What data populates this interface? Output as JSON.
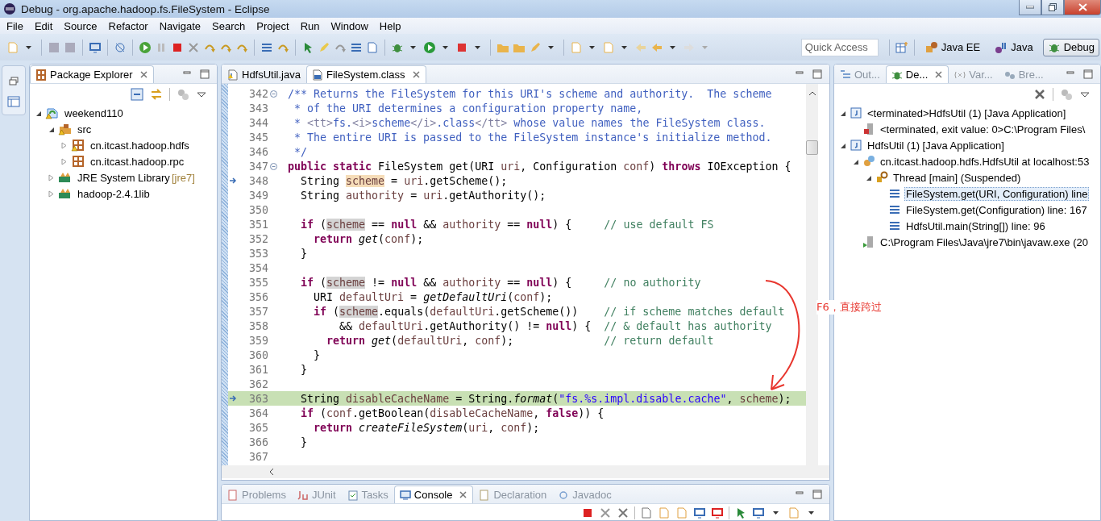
{
  "window": {
    "title": "Debug - org.apache.hadoop.fs.FileSystem - Eclipse"
  },
  "menu": [
    "File",
    "Edit",
    "Source",
    "Refactor",
    "Navigate",
    "Search",
    "Project",
    "Run",
    "Window",
    "Help"
  ],
  "quick_access": {
    "placeholder": "Quick Access"
  },
  "perspectives": [
    {
      "label": "Java EE",
      "kind": "javaee",
      "selected": false
    },
    {
      "label": "Java",
      "kind": "java",
      "selected": false
    },
    {
      "label": "Debug",
      "kind": "debug",
      "selected": true
    }
  ],
  "package_explorer": {
    "title": "Package Explorer",
    "tree": [
      {
        "label": "weekend110",
        "kind": "project",
        "warning": true,
        "expanded": true,
        "children": [
          {
            "label": "src",
            "kind": "source-folder",
            "warning": true,
            "expanded": true,
            "children": [
              {
                "label": "cn.itcast.hadoop.hdfs",
                "kind": "package",
                "warning": true,
                "expanded": false
              },
              {
                "label": "cn.itcast.hadoop.rpc",
                "kind": "package",
                "warning": false,
                "expanded": false
              }
            ]
          },
          {
            "label": "JRE System Library",
            "decoration": "[jre7]",
            "kind": "library",
            "warning": false,
            "expanded": false
          },
          {
            "label": "hadoop-2.4.1lib",
            "kind": "library",
            "warning": false,
            "expanded": false
          }
        ]
      }
    ]
  },
  "editor": {
    "tabs": [
      {
        "label": "HdfsUtil.java",
        "kind": "java",
        "selected": false
      },
      {
        "label": "FileSystem.class",
        "kind": "class",
        "selected": true
      }
    ],
    "lines": [
      {
        "number": "342",
        "foldable": true,
        "current": false,
        "stack_frame": false,
        "tokens": [
          {
            "text": "/** Returns the FileSystem for this URI's scheme and authority.  The scheme",
            "kind": "javadoc"
          }
        ]
      },
      {
        "number": "343",
        "foldable": false,
        "current": false,
        "stack_frame": false,
        "tokens": [
          {
            "text": " * of the URI determines a configuration property name,",
            "kind": "javadoc"
          }
        ]
      },
      {
        "number": "344",
        "foldable": false,
        "current": false,
        "stack_frame": false,
        "tokens": [
          {
            "text": " * ",
            "kind": "javadoc"
          },
          {
            "text": "<tt>",
            "kind": "tag"
          },
          {
            "text": "fs.",
            "kind": "javadoc"
          },
          {
            "text": "<i>",
            "kind": "tag"
          },
          {
            "text": "scheme",
            "kind": "javadoc"
          },
          {
            "text": "</i>",
            "kind": "tag"
          },
          {
            "text": ".class",
            "kind": "javadoc"
          },
          {
            "text": "</tt>",
            "kind": "tag"
          },
          {
            "text": " whose value names the FileSystem class.",
            "kind": "javadoc"
          }
        ]
      },
      {
        "number": "345",
        "foldable": false,
        "current": false,
        "stack_frame": false,
        "tokens": [
          {
            "text": " * The entire URI is passed to the FileSystem instance's initialize method.",
            "kind": "javadoc"
          }
        ]
      },
      {
        "number": "346",
        "foldable": false,
        "current": false,
        "stack_frame": false,
        "tokens": [
          {
            "text": " */",
            "kind": "javadoc"
          }
        ]
      },
      {
        "number": "347",
        "foldable": true,
        "current": false,
        "stack_frame": false,
        "tokens": [
          {
            "text": "public static",
            "kind": "keyword"
          },
          {
            "text": " FileSystem get(URI ",
            "kind": "plain"
          },
          {
            "text": "uri",
            "kind": "local"
          },
          {
            "text": ", Configuration ",
            "kind": "plain"
          },
          {
            "text": "conf",
            "kind": "local"
          },
          {
            "text": ") ",
            "kind": "plain"
          },
          {
            "text": "throws",
            "kind": "keyword"
          },
          {
            "text": " IOException {",
            "kind": "plain"
          }
        ]
      },
      {
        "number": "348",
        "foldable": false,
        "current": false,
        "stack_frame": true,
        "tokens": [
          {
            "text": "  String ",
            "kind": "plain"
          },
          {
            "text": "scheme",
            "kind": "local",
            "occurrence": true,
            "write": true
          },
          {
            "text": " = ",
            "kind": "plain"
          },
          {
            "text": "uri",
            "kind": "local"
          },
          {
            "text": ".getScheme();",
            "kind": "plain"
          }
        ]
      },
      {
        "number": "349",
        "foldable": false,
        "current": false,
        "stack_frame": false,
        "tokens": [
          {
            "text": "  String ",
            "kind": "plain"
          },
          {
            "text": "authority",
            "kind": "local"
          },
          {
            "text": " = ",
            "kind": "plain"
          },
          {
            "text": "uri",
            "kind": "local"
          },
          {
            "text": ".getAuthority();",
            "kind": "plain"
          }
        ]
      },
      {
        "number": "350",
        "foldable": false,
        "current": false,
        "stack_frame": false
      },
      {
        "number": "351",
        "foldable": false,
        "current": false,
        "stack_frame": false,
        "tokens": [
          {
            "text": "  if",
            "kind": "keyword"
          },
          {
            "text": " (",
            "kind": "plain"
          },
          {
            "text": "scheme",
            "kind": "local",
            "occurrence": true,
            "write": false
          },
          {
            "text": " == ",
            "kind": "plain"
          },
          {
            "text": "null",
            "kind": "keyword"
          },
          {
            "text": " && ",
            "kind": "plain"
          },
          {
            "text": "authority",
            "kind": "local"
          },
          {
            "text": " == ",
            "kind": "plain"
          },
          {
            "text": "null",
            "kind": "keyword"
          },
          {
            "text": ") {     ",
            "kind": "plain"
          },
          {
            "text": "// use default FS",
            "kind": "comment"
          }
        ]
      },
      {
        "number": "352",
        "foldable": false,
        "current": false,
        "stack_frame": false,
        "tokens": [
          {
            "text": "    return ",
            "kind": "keyword"
          },
          {
            "text": "get",
            "kind": "static"
          },
          {
            "text": "(",
            "kind": "plain"
          },
          {
            "text": "conf",
            "kind": "local"
          },
          {
            "text": ");",
            "kind": "plain"
          }
        ]
      },
      {
        "number": "353",
        "foldable": false,
        "current": false,
        "stack_frame": false,
        "tokens": [
          {
            "text": "  }",
            "kind": "plain"
          }
        ]
      },
      {
        "number": "354",
        "foldable": false,
        "current": false,
        "stack_frame": false
      },
      {
        "number": "355",
        "foldable": false,
        "current": false,
        "stack_frame": false,
        "tokens": [
          {
            "text": "  if",
            "kind": "keyword"
          },
          {
            "text": " (",
            "kind": "plain"
          },
          {
            "text": "scheme",
            "kind": "local",
            "occurrence": true,
            "write": false
          },
          {
            "text": " != ",
            "kind": "plain"
          },
          {
            "text": "null",
            "kind": "keyword"
          },
          {
            "text": " && ",
            "kind": "plain"
          },
          {
            "text": "authority",
            "kind": "local"
          },
          {
            "text": " == ",
            "kind": "plain"
          },
          {
            "text": "null",
            "kind": "keyword"
          },
          {
            "text": ") {     ",
            "kind": "plain"
          },
          {
            "text": "// no authority",
            "kind": "comment"
          }
        ]
      },
      {
        "number": "356",
        "foldable": false,
        "current": false,
        "stack_frame": false,
        "tokens": [
          {
            "text": "    URI ",
            "kind": "plain"
          },
          {
            "text": "defaultUri",
            "kind": "local"
          },
          {
            "text": " = ",
            "kind": "plain"
          },
          {
            "text": "getDefaultUri",
            "kind": "static"
          },
          {
            "text": "(",
            "kind": "plain"
          },
          {
            "text": "conf",
            "kind": "local"
          },
          {
            "text": ");",
            "kind": "plain"
          }
        ]
      },
      {
        "number": "357",
        "foldable": false,
        "current": false,
        "stack_frame": false,
        "tokens": [
          {
            "text": "    if",
            "kind": "keyword"
          },
          {
            "text": " (",
            "kind": "plain"
          },
          {
            "text": "scheme",
            "kind": "local",
            "occurrence": true,
            "write": false
          },
          {
            "text": ".equals(",
            "kind": "plain"
          },
          {
            "text": "defaultUri",
            "kind": "local"
          },
          {
            "text": ".getScheme())    ",
            "kind": "plain"
          },
          {
            "text": "// if scheme matches default",
            "kind": "comment"
          }
        ]
      },
      {
        "number": "358",
        "foldable": false,
        "current": false,
        "stack_frame": false,
        "tokens": [
          {
            "text": "        && ",
            "kind": "plain"
          },
          {
            "text": "defaultUri",
            "kind": "local"
          },
          {
            "text": ".getAuthority() != ",
            "kind": "plain"
          },
          {
            "text": "null",
            "kind": "keyword"
          },
          {
            "text": ") {  ",
            "kind": "plain"
          },
          {
            "text": "// & default has authority",
            "kind": "comment"
          }
        ]
      },
      {
        "number": "359",
        "foldable": false,
        "current": false,
        "stack_frame": false,
        "tokens": [
          {
            "text": "      return ",
            "kind": "keyword"
          },
          {
            "text": "get",
            "kind": "static"
          },
          {
            "text": "(",
            "kind": "plain"
          },
          {
            "text": "defaultUri",
            "kind": "local"
          },
          {
            "text": ", ",
            "kind": "plain"
          },
          {
            "text": "conf",
            "kind": "local"
          },
          {
            "text": ");              ",
            "kind": "plain"
          },
          {
            "text": "// return default",
            "kind": "comment"
          }
        ]
      },
      {
        "number": "360",
        "foldable": false,
        "current": false,
        "stack_frame": false,
        "tokens": [
          {
            "text": "    }",
            "kind": "plain"
          }
        ]
      },
      {
        "number": "361",
        "foldable": false,
        "current": false,
        "stack_frame": false,
        "tokens": [
          {
            "text": "  }",
            "kind": "plain"
          }
        ]
      },
      {
        "number": "362",
        "foldable": false,
        "current": false,
        "stack_frame": false
      },
      {
        "number": "363",
        "foldable": false,
        "current": true,
        "stack_frame": true,
        "tokens": [
          {
            "text": "  String ",
            "kind": "plain"
          },
          {
            "text": "disableCacheName",
            "kind": "local"
          },
          {
            "text": " = String.",
            "kind": "plain"
          },
          {
            "text": "format",
            "kind": "static"
          },
          {
            "text": "(",
            "kind": "plain"
          },
          {
            "text": "\"fs.%s.impl.disable.cache\"",
            "kind": "string"
          },
          {
            "text": ", ",
            "kind": "plain"
          },
          {
            "text": "scheme",
            "kind": "local"
          },
          {
            "text": ");",
            "kind": "plain"
          }
        ]
      },
      {
        "number": "364",
        "foldable": false,
        "current": false,
        "stack_frame": false,
        "tokens": [
          {
            "text": "  if",
            "kind": "keyword"
          },
          {
            "text": " (",
            "kind": "plain"
          },
          {
            "text": "conf",
            "kind": "local"
          },
          {
            "text": ".getBoolean(",
            "kind": "plain"
          },
          {
            "text": "disableCacheName",
            "kind": "local"
          },
          {
            "text": ", ",
            "kind": "plain"
          },
          {
            "text": "false",
            "kind": "keyword"
          },
          {
            "text": ")) {",
            "kind": "plain"
          }
        ]
      },
      {
        "number": "365",
        "foldable": false,
        "current": false,
        "stack_frame": false,
        "tokens": [
          {
            "text": "    return ",
            "kind": "keyword"
          },
          {
            "text": "createFileSystem",
            "kind": "static"
          },
          {
            "text": "(",
            "kind": "plain"
          },
          {
            "text": "uri",
            "kind": "local"
          },
          {
            "text": ", ",
            "kind": "plain"
          },
          {
            "text": "conf",
            "kind": "local"
          },
          {
            "text": ");",
            "kind": "plain"
          }
        ]
      },
      {
        "number": "366",
        "foldable": false,
        "current": false,
        "stack_frame": false,
        "tokens": [
          {
            "text": "  }",
            "kind": "plain"
          }
        ]
      },
      {
        "number": "367",
        "foldable": false,
        "current": false,
        "stack_frame": false
      }
    ],
    "annotation": {
      "text": "F6，直接跨过"
    }
  },
  "debug_view": {
    "tabs": [
      {
        "label": "Out...",
        "kind": "outline",
        "selected": false
      },
      {
        "label": "De...",
        "kind": "debug",
        "selected": true
      },
      {
        "label": "Var...",
        "kind": "variables",
        "selected": false
      },
      {
        "label": "Bre...",
        "kind": "breakpoints",
        "selected": false
      }
    ],
    "tree": [
      {
        "label": "<terminated>HdfsUtil (1) [Java Application]",
        "kind": "launch",
        "selected": false,
        "expanded": true,
        "children": [
          {
            "label": "<terminated, exit value: 0>C:\\Program Files\\",
            "kind": "terminated-process",
            "selected": false
          }
        ]
      },
      {
        "label": "HdfsUtil (1) [Java Application]",
        "kind": "launch",
        "selected": false,
        "expanded": true,
        "children": [
          {
            "label": "cn.itcast.hadoop.hdfs.HdfsUtil at localhost:53",
            "kind": "debug-target",
            "selected": false,
            "expanded": true,
            "children": [
              {
                "label": "Thread [main] (Suspended)",
                "kind": "thread",
                "selected": false,
                "expanded": true,
                "children": [
                  {
                    "label": "FileSystem.get(URI, Configuration) line",
                    "kind": "stack-frame",
                    "selected": true
                  },
                  {
                    "label": "FileSystem.get(Configuration) line: 167",
                    "kind": "stack-frame",
                    "selected": false
                  },
                  {
                    "label": "HdfsUtil.main(String[]) line: 96",
                    "kind": "stack-frame",
                    "selected": false
                  }
                ]
              }
            ]
          },
          {
            "label": "C:\\Program Files\\Java\\jre7\\bin\\javaw.exe (20",
            "kind": "process",
            "selected": false
          }
        ]
      }
    ]
  },
  "bottom_panel": {
    "tabs": [
      {
        "label": "Problems",
        "kind": "problems",
        "selected": false
      },
      {
        "label": "JUnit",
        "kind": "junit",
        "selected": false
      },
      {
        "label": "Tasks",
        "kind": "tasks",
        "selected": false
      },
      {
        "label": "Console",
        "kind": "console",
        "selected": true
      },
      {
        "label": "Declaration",
        "kind": "declaration",
        "selected": false
      },
      {
        "label": "Javadoc",
        "kind": "javadoc",
        "selected": false
      }
    ]
  }
}
